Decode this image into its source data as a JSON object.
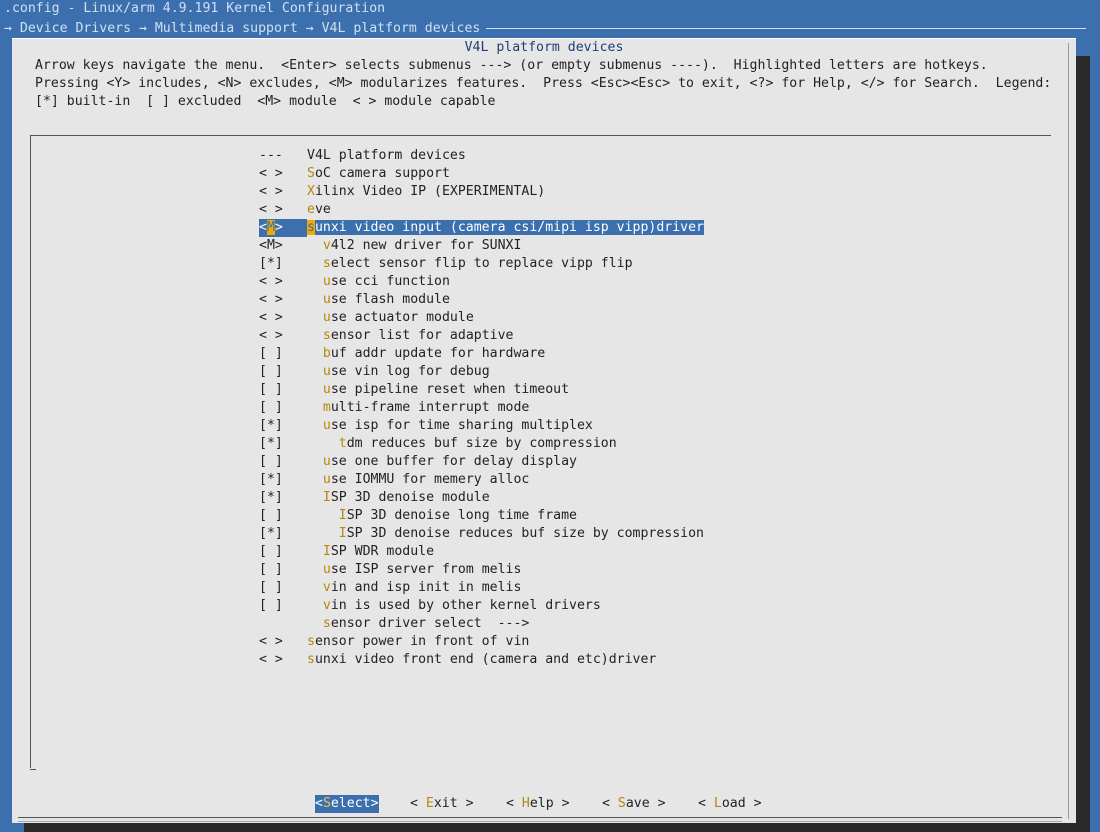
{
  "window_title": ".config - Linux/arm 4.9.191 Kernel Configuration",
  "breadcrumb": "→ Device Drivers → Multimedia support → V4L platform devices",
  "dialog_title": "V4L platform devices",
  "help_lines": [
    "Arrow keys navigate the menu.  <Enter> selects submenus ---> (or empty submenus ----).  Highlighted letters are hotkeys.",
    "Pressing <Y> includes, <N> excludes, <M> modularizes features.  Press <Esc><Esc> to exit, <?> for Help, </> for Search.  Legend:",
    "[*] built-in  [ ] excluded  <M> module  < > module capable"
  ],
  "menu_items": [
    {
      "mark": "---",
      "indent": "",
      "hotkey": "",
      "rest": "V4L platform devices",
      "selected": false
    },
    {
      "mark": "< >",
      "indent": "",
      "hotkey": "S",
      "rest": "oC camera support",
      "selected": false
    },
    {
      "mark": "< >",
      "indent": "",
      "hotkey": "X",
      "rest": "ilinx Video IP (EXPERIMENTAL)",
      "selected": false
    },
    {
      "mark": "< >",
      "indent": "",
      "hotkey": "e",
      "rest": "ve",
      "selected": false
    },
    {
      "mark": "<M>",
      "indent": "",
      "hotkey": "s",
      "rest": "unxi video input (camera csi/mipi isp vipp)driver",
      "selected": true
    },
    {
      "mark": "<M>",
      "indent": "  ",
      "hotkey": "v",
      "rest": "4l2 new driver for SUNXI",
      "selected": false
    },
    {
      "mark": "[*]",
      "indent": "  ",
      "hotkey": "s",
      "rest": "elect sensor flip to replace vipp flip",
      "selected": false
    },
    {
      "mark": "< >",
      "indent": "  ",
      "hotkey": "u",
      "rest": "se cci function",
      "selected": false
    },
    {
      "mark": "< >",
      "indent": "  ",
      "hotkey": "u",
      "rest": "se flash module",
      "selected": false
    },
    {
      "mark": "< >",
      "indent": "  ",
      "hotkey": "u",
      "rest": "se actuator module",
      "selected": false
    },
    {
      "mark": "< >",
      "indent": "  ",
      "hotkey": "s",
      "rest": "ensor list for adaptive",
      "selected": false
    },
    {
      "mark": "[ ]",
      "indent": "  ",
      "hotkey": "b",
      "rest": "uf addr update for hardware",
      "selected": false
    },
    {
      "mark": "[ ]",
      "indent": "  ",
      "hotkey": "u",
      "rest": "se vin log for debug",
      "selected": false
    },
    {
      "mark": "[ ]",
      "indent": "  ",
      "hotkey": "u",
      "rest": "se pipeline reset when timeout",
      "selected": false
    },
    {
      "mark": "[ ]",
      "indent": "  ",
      "hotkey": "m",
      "rest": "ulti-frame interrupt mode",
      "selected": false
    },
    {
      "mark": "[*]",
      "indent": "  ",
      "hotkey": "u",
      "rest": "se isp for time sharing multiplex",
      "selected": false
    },
    {
      "mark": "[*]",
      "indent": "    ",
      "hotkey": "t",
      "rest": "dm reduces buf size by compression",
      "selected": false
    },
    {
      "mark": "[ ]",
      "indent": "  ",
      "hotkey": "u",
      "rest": "se one buffer for delay display",
      "selected": false
    },
    {
      "mark": "[*]",
      "indent": "  ",
      "hotkey": "u",
      "rest": "se IOMMU for memery alloc",
      "selected": false
    },
    {
      "mark": "[*]",
      "indent": "  ",
      "hotkey": "I",
      "rest": "SP 3D denoise module",
      "selected": false
    },
    {
      "mark": "[ ]",
      "indent": "    ",
      "hotkey": "I",
      "rest": "SP 3D denoise long time frame",
      "selected": false
    },
    {
      "mark": "[*]",
      "indent": "    ",
      "hotkey": "I",
      "rest": "SP 3D denoise reduces buf size by compression",
      "selected": false
    },
    {
      "mark": "[ ]",
      "indent": "  ",
      "hotkey": "I",
      "rest": "SP WDR module",
      "selected": false
    },
    {
      "mark": "[ ]",
      "indent": "  ",
      "hotkey": "u",
      "rest": "se ISP server from melis",
      "selected": false
    },
    {
      "mark": "[ ]",
      "indent": "  ",
      "hotkey": "v",
      "rest": "in and isp init in melis",
      "selected": false
    },
    {
      "mark": "[ ]",
      "indent": "  ",
      "hotkey": "v",
      "rest": "in is used by other kernel drivers",
      "selected": false
    },
    {
      "mark": "",
      "indent": "  ",
      "hotkey": "s",
      "rest": "ensor driver select  --->",
      "selected": false
    },
    {
      "mark": "< >",
      "indent": "",
      "hotkey": "s",
      "rest": "ensor power in front of vin",
      "selected": false
    },
    {
      "mark": "< >",
      "indent": "",
      "hotkey": "s",
      "rest": "unxi video front end (camera and etc)driver",
      "selected": false
    }
  ],
  "buttons": [
    {
      "pre": "<",
      "hotkey": "S",
      "rest": "elect>",
      "selected": true
    },
    {
      "pre": "< ",
      "hotkey": "E",
      "rest": "xit >",
      "selected": false
    },
    {
      "pre": "< ",
      "hotkey": "H",
      "rest": "elp >",
      "selected": false
    },
    {
      "pre": "< ",
      "hotkey": "S",
      "rest": "ave >",
      "selected": false
    },
    {
      "pre": "< ",
      "hotkey": "L",
      "rest": "oad >",
      "selected": false
    }
  ]
}
